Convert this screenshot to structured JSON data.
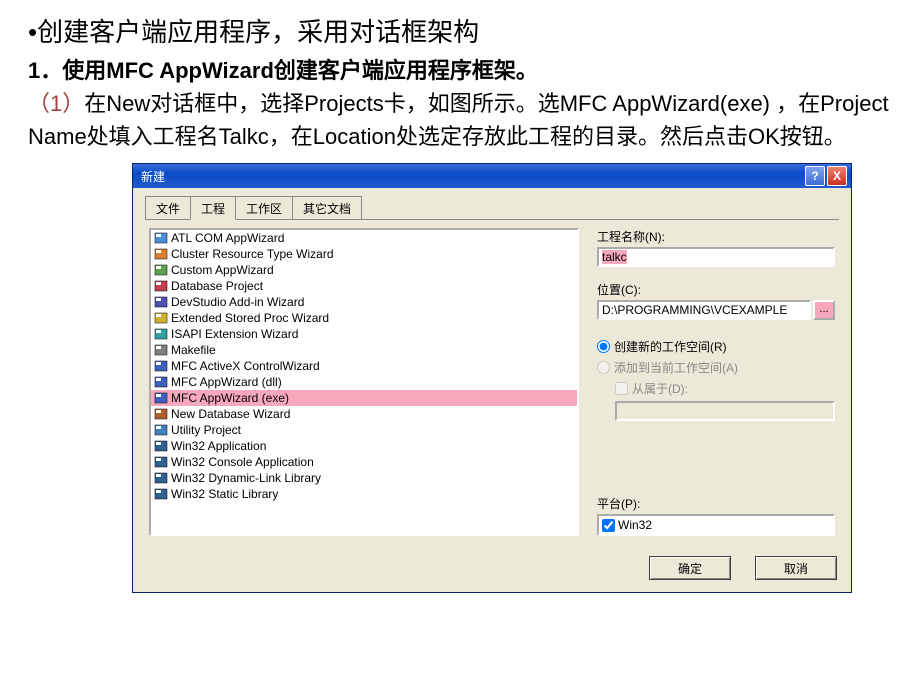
{
  "doc": {
    "bullet_heading": "•创建客户端应用程序，采用对话框架构",
    "step1_label": "1．使用",
    "step1_bold": "MFC AppWizard",
    "step1_tail": "创建客户端应用程序框架。",
    "desc_idx": "（1）",
    "desc_rest": "在New对话框中，选择Projects卡，如图所示。选MFC AppWizard(exe) ，在Project Name处填入工程名Talkc，在Location处选定存放此工程的目录。然后点击OK按钮。"
  },
  "dialog": {
    "title": "新建",
    "help": "?",
    "close": "X",
    "tabs": [
      "文件",
      "工程",
      "工作区",
      "其它文档"
    ],
    "active_tab": 1,
    "list": [
      "ATL COM AppWizard",
      "Cluster Resource Type Wizard",
      "Custom AppWizard",
      "Database Project",
      "DevStudio Add-in Wizard",
      "Extended Stored Proc Wizard",
      "ISAPI Extension Wizard",
      "Makefile",
      "MFC ActiveX ControlWizard",
      "MFC AppWizard (dll)",
      "MFC AppWizard (exe)",
      "New Database Wizard",
      "Utility Project",
      "Win32 Application",
      "Win32 Console Application",
      "Win32 Dynamic-Link Library",
      "Win32 Static Library"
    ],
    "selected_index": 10,
    "labels": {
      "project_name": "工程名称(N):",
      "location": "位置(C):",
      "radio_new": "创建新的工作空间(R)",
      "radio_add": "添加到当前工作空间(A)",
      "check_depend": "从属于(D):",
      "platform": "平台(P):"
    },
    "values": {
      "project_name": "talkc",
      "location": "D:\\PROGRAMMING\\VCEXAMPLE",
      "platform": "Win32"
    },
    "browse": "...",
    "buttons": {
      "ok": "确定",
      "cancel": "取消"
    }
  },
  "icons": {
    "colors": [
      "#4a90d9",
      "#d98030",
      "#60a050",
      "#c04050",
      "#5050b0",
      "#d0b030",
      "#30a0a0",
      "#808080",
      "#4060c0",
      "#4060c0",
      "#4060c0",
      "#b06030",
      "#4080c0",
      "#306090",
      "#306090",
      "#306090",
      "#306090"
    ]
  }
}
